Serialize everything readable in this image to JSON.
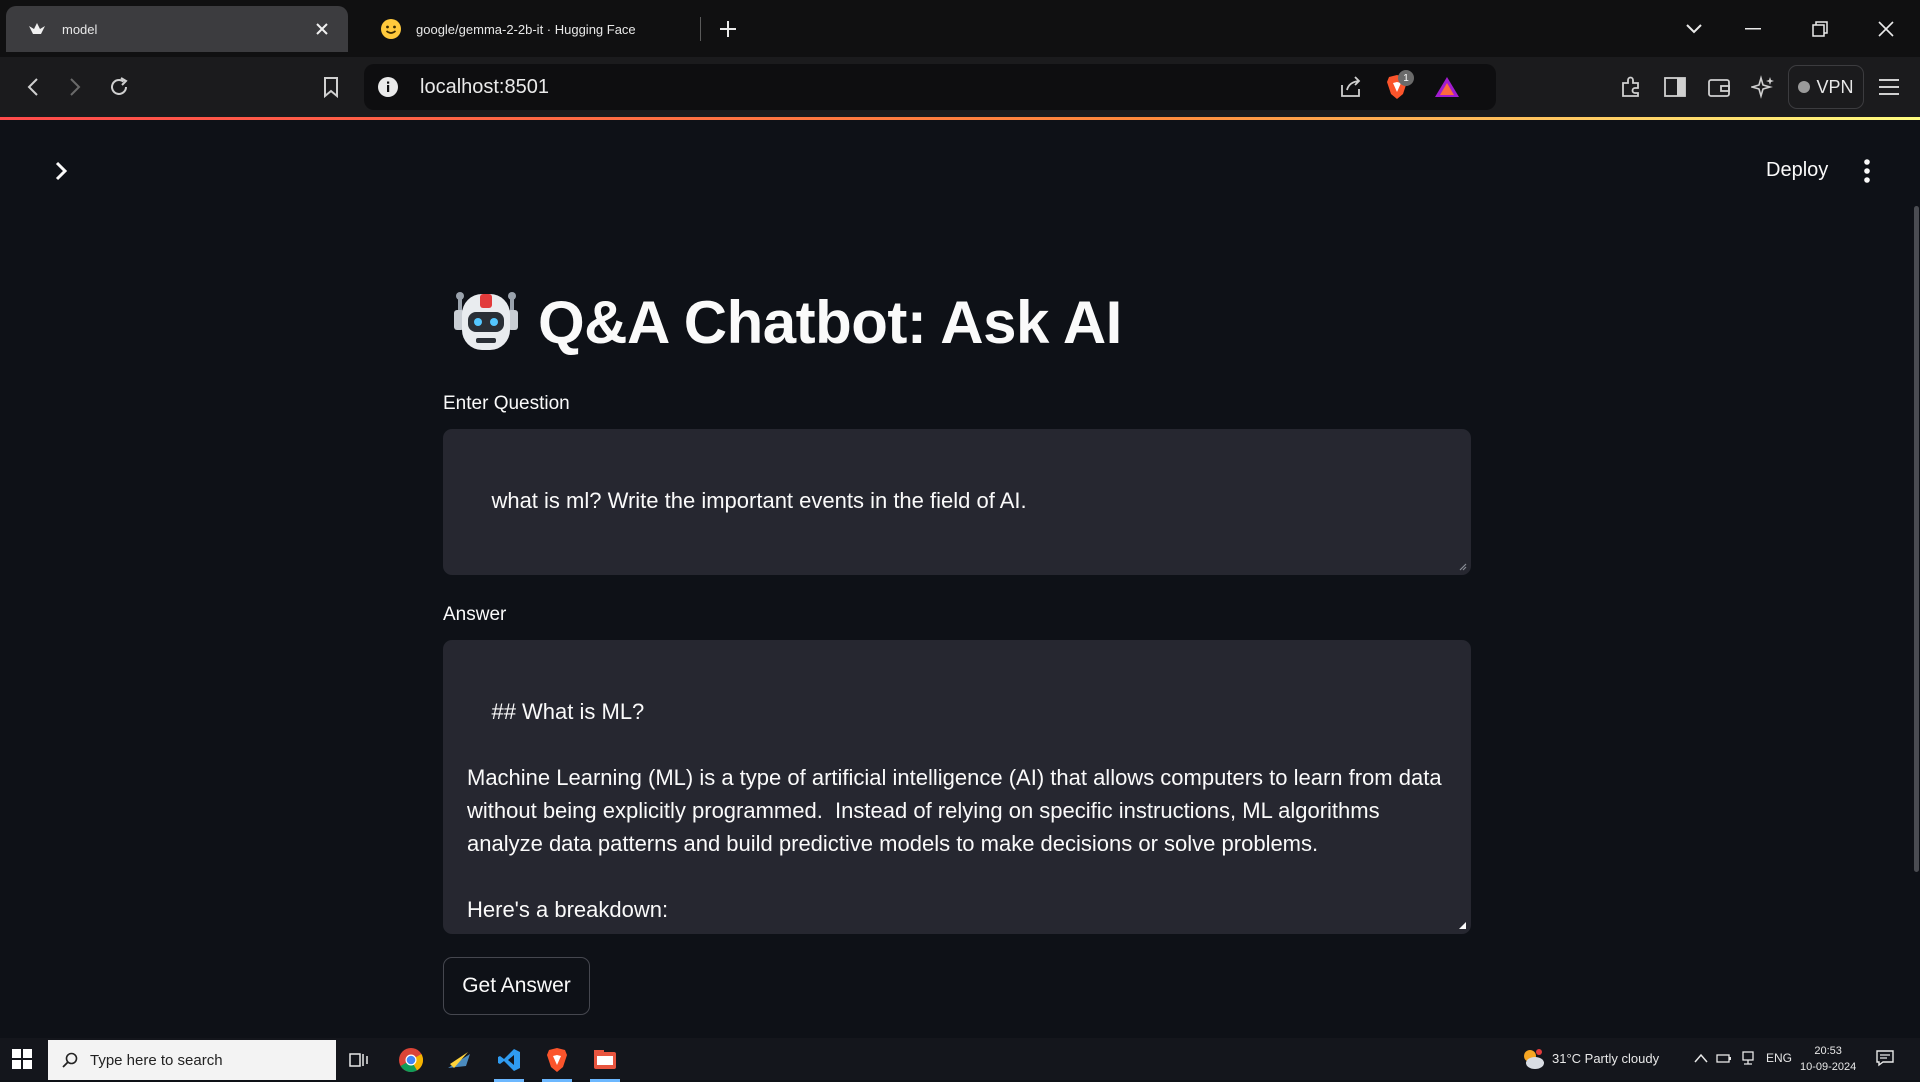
{
  "browser": {
    "tabs": [
      {
        "title": "model",
        "active": true
      },
      {
        "title": "google/gemma-2-2b-it · Hugging Face",
        "active": false
      }
    ],
    "url": "localhost:8501",
    "brave_shield_count": "1",
    "vpn_label": "VPN"
  },
  "app": {
    "deploy_label": "Deploy",
    "title": "Q&A Chatbot: Ask AI",
    "question_label": "Enter Question",
    "question_value": "what is ml? Write the important events in the field of AI.",
    "answer_label": "Answer",
    "answer_value": "## What is ML?\n\nMachine Learning (ML) is a type of artificial intelligence (AI) that allows computers to learn from data without being explicitly programmed.  Instead of relying on specific instructions, ML algorithms analyze data patterns and build predictive models to make decisions or solve problems.\n\nHere's a breakdown:",
    "button_label": "Get Answer"
  },
  "taskbar": {
    "search_placeholder": "Type here to search",
    "weather": "31°C  Partly cloudy",
    "language": "ENG",
    "time": "20:53",
    "date": "10-09-2024"
  },
  "colors": {
    "app_bg": "#0e1117",
    "input_bg": "#262730",
    "accent": "#ff4b4b"
  }
}
